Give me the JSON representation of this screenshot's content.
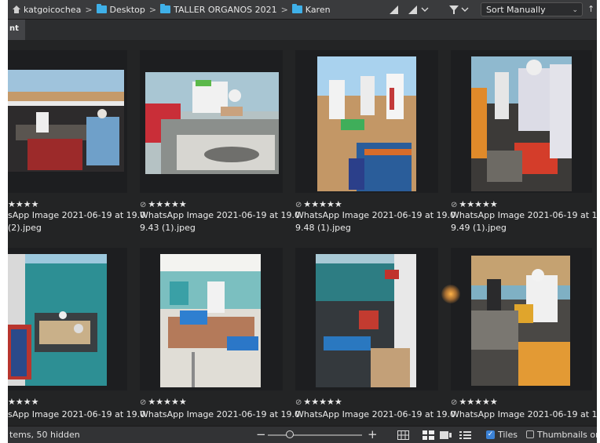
{
  "path": {
    "items": [
      "katgoicochea",
      "Desktop",
      "TALLER ORGANOS 2021",
      "Karen"
    ],
    "separator": ">"
  },
  "toolbar": {
    "sort_value": "Sort Manually",
    "sort_chevron": "⌄",
    "pin": "↑"
  },
  "tab": {
    "label": "nt"
  },
  "files": [
    {
      "name_line1": "sApp Image 2021-06-19 at 19.0",
      "name_line2": "(2).jpeg",
      "rating": "★★★★",
      "no_rating": ""
    },
    {
      "name_line1": "WhatsApp Image 2021-06-19 at 19.0",
      "name_line2": "9.43 (1).jpeg",
      "rating": "★★★★★",
      "no_rating": "⊘"
    },
    {
      "name_line1": "WhatsApp Image 2021-06-19 at 19.0",
      "name_line2": "9.48 (1).jpeg",
      "rating": "★★★★★",
      "no_rating": "⊘"
    },
    {
      "name_line1": "WhatsApp Image 2021-06-19 at 19.0",
      "name_line2": "9.49 (1).jpeg",
      "rating": "★★★★★",
      "no_rating": "⊘"
    },
    {
      "name_line1": "sApp Image 2021-06-19 at 19.0",
      "name_line2": "",
      "rating": "★★★★",
      "no_rating": ""
    },
    {
      "name_line1": "WhatsApp Image 2021-06-19 at 19.0",
      "name_line2": "",
      "rating": "★★★★★",
      "no_rating": "⊘"
    },
    {
      "name_line1": "WhatsApp Image 2021-06-19 at 19.0",
      "name_line2": "",
      "rating": "★★★★★",
      "no_rating": "⊘"
    },
    {
      "name_line1": "WhatsApp Image 2021-06-19 at 19.0",
      "name_line2": "",
      "rating": "★★★★★",
      "no_rating": "⊘"
    }
  ],
  "statusbar": {
    "count_text": "tems, 50 hidden",
    "zoom_minus": "−",
    "zoom_plus": "+",
    "tiles_label": "Tiles",
    "tiles_check": "✓",
    "thumbnails_label": "Thumbnails only"
  },
  "colors": {
    "accent": "#3fb0e8",
    "check": "#3b82d6",
    "background": "#232425"
  }
}
